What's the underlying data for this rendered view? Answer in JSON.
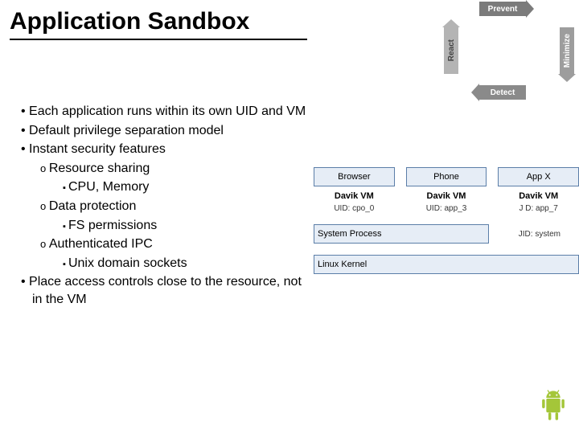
{
  "title": "Application Sandbox",
  "bullets": {
    "b1": "Each application runs within its own UID and VM",
    "b2": "Default privilege separation model",
    "b3": "Instant security features",
    "b3a": "Resource sharing",
    "b3a1": "CPU, Memory",
    "b3b": "Data protection",
    "b3b1": "FS permissions",
    "b3c": "Authenticated IPC",
    "b3c1": "Unix domain sockets",
    "b4": "Place access controls close to the resource, not in the VM"
  },
  "cycle": {
    "top": "Prevent",
    "right": "Minimize",
    "bottom": "Detect",
    "left": "React"
  },
  "arch": {
    "apps": [
      {
        "name": "Browser",
        "vm": "Davik VM",
        "uid": "UID: cpo_0"
      },
      {
        "name": "Phone",
        "vm": "Davik VM",
        "uid": "UID: app_3"
      },
      {
        "name": "App X",
        "vm": "Davik VM",
        "uid": "J D: app_7"
      }
    ],
    "system": {
      "name": "System Process",
      "uid": "JID: system"
    },
    "kernel": "Linux Kernel"
  }
}
